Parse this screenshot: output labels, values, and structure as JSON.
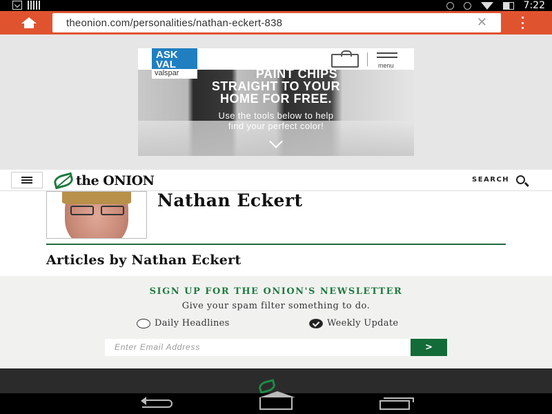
{
  "status_bar": {
    "time": "7:22",
    "icons": [
      "download-icon",
      "barcode-icon",
      "bluetooth-icon",
      "airplane-icon",
      "wifi-icon",
      "battery-icon"
    ]
  },
  "browser": {
    "url": "theonion.com/personalities/nathan-eckert-838",
    "toolbar_color": "#e0532f",
    "icons": {
      "home": "home-icon",
      "clear": "clear-icon",
      "menu": "overflow-menu-icon"
    }
  },
  "ad": {
    "brand_line1": "ASK",
    "brand_line2": "VAL",
    "brand_name": "valspar",
    "menu_label": "menu",
    "headline_line1": "PAINT CHIPS",
    "headline_line2": "STRAIGHT TO YOUR",
    "headline_line3": "HOME FOR FREE.",
    "sub_line1": "Use the tools below to help",
    "sub_line2": "find your perfect color!",
    "brand_color": "#1f7fc1"
  },
  "site": {
    "logo_text": "the ONION",
    "search_label": "SEARCH",
    "accent_color": "#1e7a3e"
  },
  "author": {
    "name": "Nathan Eckert",
    "articles_heading": "Articles by Nathan Eckert"
  },
  "newsletter": {
    "title": "SIGN UP FOR THE ONION'S NEWSLETTER",
    "subtitle": "Give your spam filter something to do.",
    "options": [
      {
        "label": "Daily Headlines",
        "selected": false
      },
      {
        "label": "Weekly Update",
        "selected": true
      }
    ],
    "email_placeholder": "Enter Email Address",
    "submit_label": ">",
    "button_color": "#136b37"
  }
}
